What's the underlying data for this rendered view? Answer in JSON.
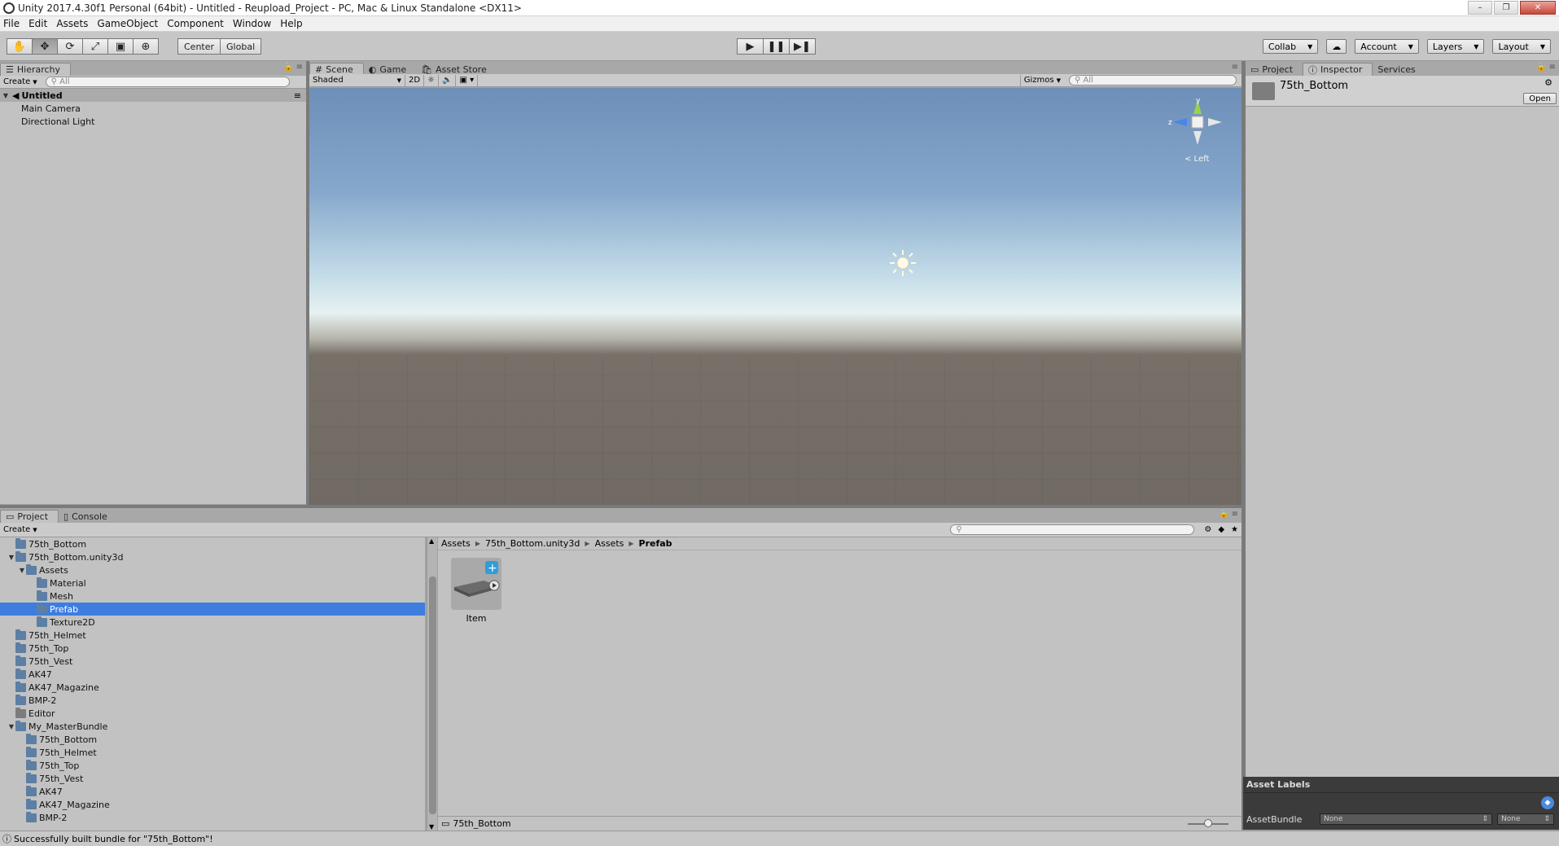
{
  "window": {
    "title": "Unity 2017.4.30f1 Personal (64bit) - Untitled - Reupload_Project - PC, Mac & Linux Standalone <DX11>",
    "controls": [
      "–",
      "❐",
      "✕"
    ]
  },
  "menu": [
    "File",
    "Edit",
    "Assets",
    "GameObject",
    "Component",
    "Window",
    "Help"
  ],
  "toolbar": {
    "tools": [
      "✋",
      "✥",
      "⟳",
      "⤢",
      "▣",
      "⊕"
    ],
    "pivot": "Center",
    "space": "Global",
    "play": "▶",
    "pause": "❚❚",
    "step": "▶❚",
    "collab": "Collab",
    "account": "Account",
    "layers": "Layers",
    "layout": "Layout"
  },
  "hierarchy": {
    "tab": "Hierarchy",
    "create": "Create",
    "search_placeholder": "All",
    "scene": "Untitled",
    "items": [
      "Main Camera",
      "Directional Light"
    ]
  },
  "scene": {
    "tabs": [
      "Scene",
      "Game",
      "Asset Store"
    ],
    "shading": "Shaded",
    "mode_2d": "2D",
    "gizmos": "Gizmos",
    "search_placeholder": "All",
    "gizmo_labels": {
      "y": "y",
      "z": "z",
      "view": "< Left"
    }
  },
  "inspector": {
    "tabs": [
      "Project",
      "Inspector",
      "Services"
    ],
    "asset_name": "75th_Bottom",
    "open_button": "Open",
    "asset_labels_title": "Asset Labels",
    "assetbundle_label": "AssetBundle",
    "bundle_value": "None",
    "variant_value": "None"
  },
  "project": {
    "tabs": [
      "Project",
      "Console"
    ],
    "create": "Create",
    "tree": [
      {
        "label": "75th_Bottom",
        "depth": 1,
        "expander": "",
        "icon": "bundle"
      },
      {
        "label": "75th_Bottom.unity3d",
        "depth": 1,
        "expander": "▼",
        "icon": "bundle"
      },
      {
        "label": "Assets",
        "depth": 2,
        "expander": "▼",
        "icon": "bundle"
      },
      {
        "label": "Material",
        "depth": 3,
        "expander": "",
        "icon": "bundle"
      },
      {
        "label": "Mesh",
        "depth": 3,
        "expander": "",
        "icon": "bundle"
      },
      {
        "label": "Prefab",
        "depth": 3,
        "expander": "",
        "icon": "bundle",
        "selected": true
      },
      {
        "label": "Texture2D",
        "depth": 3,
        "expander": "",
        "icon": "bundle"
      },
      {
        "label": "75th_Helmet",
        "depth": 1,
        "expander": "",
        "icon": "bundle"
      },
      {
        "label": "75th_Top",
        "depth": 1,
        "expander": "",
        "icon": "bundle"
      },
      {
        "label": "75th_Vest",
        "depth": 1,
        "expander": "",
        "icon": "bundle"
      },
      {
        "label": "AK47",
        "depth": 1,
        "expander": "",
        "icon": "bundle"
      },
      {
        "label": "AK47_Magazine",
        "depth": 1,
        "expander": "",
        "icon": "bundle"
      },
      {
        "label": "BMP-2",
        "depth": 1,
        "expander": "",
        "icon": "bundle"
      },
      {
        "label": "Editor",
        "depth": 1,
        "expander": "",
        "icon": "plain"
      },
      {
        "label": "My_MasterBundle",
        "depth": 1,
        "expander": "▼",
        "icon": "bundle"
      },
      {
        "label": "75th_Bottom",
        "depth": 2,
        "expander": "",
        "icon": "bundle"
      },
      {
        "label": "75th_Helmet",
        "depth": 2,
        "expander": "",
        "icon": "bundle"
      },
      {
        "label": "75th_Top",
        "depth": 2,
        "expander": "",
        "icon": "bundle"
      },
      {
        "label": "75th_Vest",
        "depth": 2,
        "expander": "",
        "icon": "bundle"
      },
      {
        "label": "AK47",
        "depth": 2,
        "expander": "",
        "icon": "bundle"
      },
      {
        "label": "AK47_Magazine",
        "depth": 2,
        "expander": "",
        "icon": "bundle"
      },
      {
        "label": "BMP-2",
        "depth": 2,
        "expander": "",
        "icon": "bundle"
      }
    ],
    "breadcrumbs": [
      "Assets",
      "75th_Bottom.unity3d",
      "Assets",
      "Prefab"
    ],
    "asset_item": "Item",
    "footer_path": "75th_Bottom"
  },
  "status": {
    "message": "Successfully built bundle for \"75th_Bottom\"!"
  },
  "colors": {
    "selection": "#3e7de0",
    "folder": "#5c7fa3",
    "panel_bg": "#c2c2c2",
    "dark_section": "#3b3b3b"
  }
}
